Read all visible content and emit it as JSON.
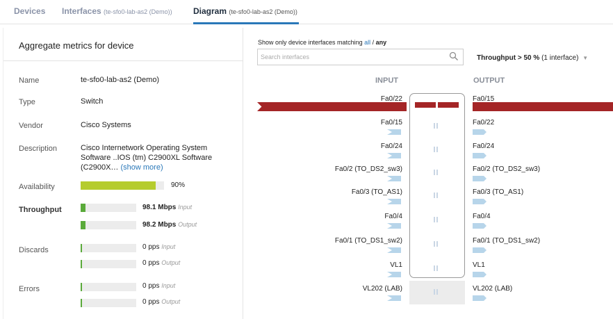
{
  "tabs": [
    {
      "label": "Devices",
      "sub": ""
    },
    {
      "label": "Interfaces",
      "sub": "(te-sfo0-lab-as2 (Demo))"
    },
    {
      "label": "Diagram",
      "sub": "(te-sfo0-lab-as2 (Demo))"
    }
  ],
  "left": {
    "title": "Aggregate metrics for device",
    "name_label": "Name",
    "name_value": "te-sfo0-lab-as2 (Demo)",
    "type_label": "Type",
    "type_value": "Switch",
    "vendor_label": "Vendor",
    "vendor_value": "Cisco Systems",
    "description_label": "Description",
    "description_line1": "Cisco Internetwork Operating System",
    "description_line2": "Software ..IOS (tm) C2900XL Software",
    "description_line3": "(C2900X…",
    "show_more": "(show more)",
    "availability_label": "Availability",
    "availability_value": "90%",
    "availability_fraction": 0.9,
    "throughput_label": "Throughput",
    "throughput_input": "98.1 Mbps",
    "throughput_output": "98.2 Mbps",
    "input_tag": "Input",
    "output_tag": "Output",
    "discards_label": "Discards",
    "discards_input": "0 pps",
    "discards_output": "0 pps",
    "errors_label": "Errors",
    "errors_input": "0 pps",
    "errors_output": "0 pps",
    "colors": {
      "availability": "#b5cc2e",
      "throughput": "#5aaa3a",
      "small": "#5aaa3a"
    }
  },
  "filter": {
    "label_prefix": "Show only device interfaces matching",
    "all": "all",
    "separator": "/",
    "any": "any",
    "search_placeholder": "Search interfaces",
    "throughput_bold": "Throughput > 50 %",
    "throughput_count": "(1 interface)"
  },
  "diagram": {
    "input_header": "INPUT",
    "output_header": "OUTPUT",
    "rows": [
      {
        "input": "Fa0/22",
        "output": "Fa0/15"
      },
      {
        "input": "Fa0/15",
        "output": "Fa0/22"
      },
      {
        "input": "Fa0/24",
        "output": "Fa0/24"
      },
      {
        "input": "Fa0/2 (TO_DS2_sw3)",
        "output": "Fa0/2 (TO_DS2_sw3)"
      },
      {
        "input": "Fa0/3 (TO_AS1)",
        "output": "Fa0/3 (TO_AS1)"
      },
      {
        "input": "Fa0/4",
        "output": "Fa0/4"
      },
      {
        "input": "Fa0/1 (TO_DS1_sw2)",
        "output": "Fa0/1 (TO_DS1_sw2)"
      },
      {
        "input": "VL1",
        "output": "VL1"
      },
      {
        "input": "VL202 (LAB)",
        "output": "VL202 (LAB)"
      }
    ],
    "colors": {
      "high": "#a42526",
      "low": "#b7d5ea"
    }
  }
}
